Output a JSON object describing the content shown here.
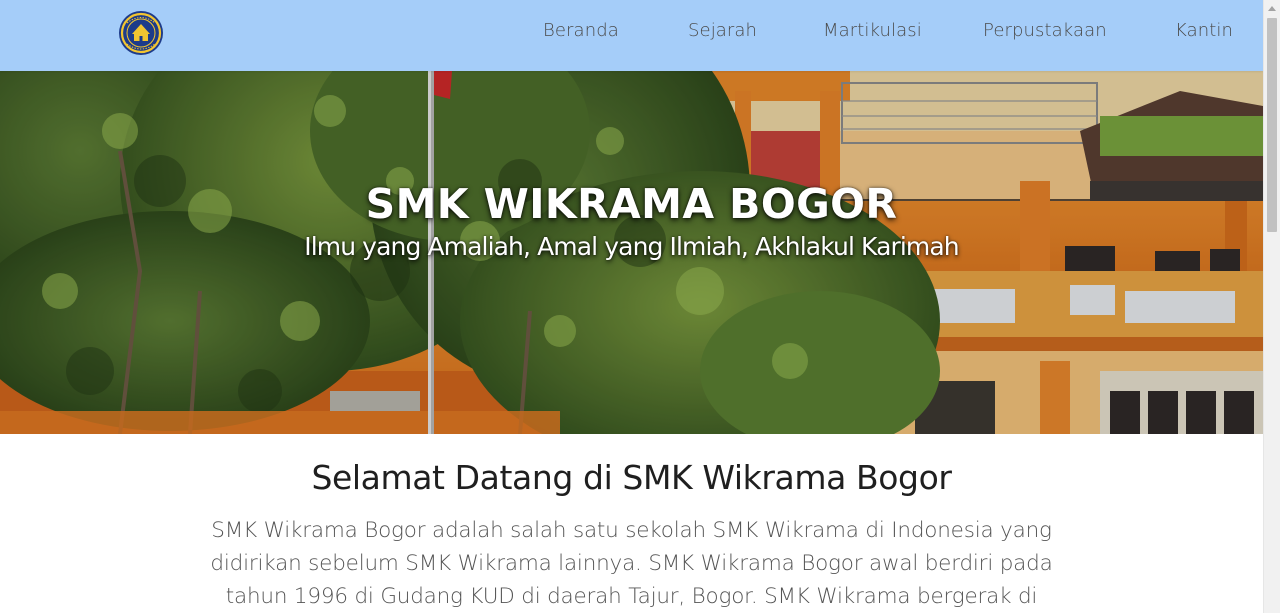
{
  "navbar": {
    "logo": {
      "icon": "school-crest-icon",
      "alt": "SMK Wikrama logo"
    },
    "links": [
      {
        "label": "Beranda"
      },
      {
        "label": "Sejarah"
      },
      {
        "label": "Martikulasi"
      },
      {
        "label": "Perpustakaan"
      },
      {
        "label": "Kantin"
      }
    ],
    "background": "#a5cdf9",
    "link_color": "#4b4b4b"
  },
  "hero": {
    "title": "SMK WIKRAMA BOGOR",
    "subtitle": "Ilmu yang Amaliah, Amal yang Ilmiah, Akhlakul Karimah",
    "image": "school-building-photo"
  },
  "main": {
    "heading": "Selamat Datang di SMK Wikrama Bogor",
    "intro_lines": [
      "SMK Wikrama Bogor adalah salah satu sekolah SMK Wikrama di Indonesia yang",
      "didirikan sebelum SMK Wikrama lainnya. SMK Wikrama Bogor awal berdiri pada",
      "tahun 1996 di Gudang KUD di daerah Tajur, Bogor. SMK Wikrama bergerak di"
    ]
  },
  "scrollbar": {
    "thumb_color": "#c1c1c1"
  }
}
